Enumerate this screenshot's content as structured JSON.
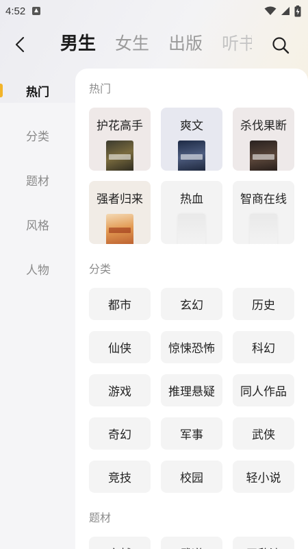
{
  "status_bar": {
    "time": "4:52"
  },
  "header": {
    "tabs": [
      {
        "label": "男生"
      },
      {
        "label": "女生"
      },
      {
        "label": "出版"
      },
      {
        "label": "听书"
      }
    ]
  },
  "sidebar": {
    "items": [
      {
        "label": "热门"
      },
      {
        "label": "分类"
      },
      {
        "label": "题材"
      },
      {
        "label": "风格"
      },
      {
        "label": "人物"
      }
    ]
  },
  "hot": {
    "title": "热门",
    "items": [
      {
        "label": "护花高手"
      },
      {
        "label": "爽文"
      },
      {
        "label": "杀伐果断"
      },
      {
        "label": "强者归来"
      },
      {
        "label": "热血"
      },
      {
        "label": "智商在线"
      }
    ]
  },
  "category": {
    "title": "分类",
    "items": [
      {
        "label": "都市"
      },
      {
        "label": "玄幻"
      },
      {
        "label": "历史"
      },
      {
        "label": "仙侠"
      },
      {
        "label": "惊悚恐怖"
      },
      {
        "label": "科幻"
      },
      {
        "label": "游戏"
      },
      {
        "label": "推理悬疑"
      },
      {
        "label": "同人作品"
      },
      {
        "label": "奇幻"
      },
      {
        "label": "军事"
      },
      {
        "label": "武侠"
      },
      {
        "label": "竞技"
      },
      {
        "label": "校园"
      },
      {
        "label": "轻小说"
      }
    ]
  },
  "topic": {
    "title": "题材",
    "items": [
      {
        "label": "穿越"
      },
      {
        "label": "武道"
      },
      {
        "label": "无敌流"
      }
    ]
  },
  "colors": {
    "accent": "#f2b42a"
  }
}
